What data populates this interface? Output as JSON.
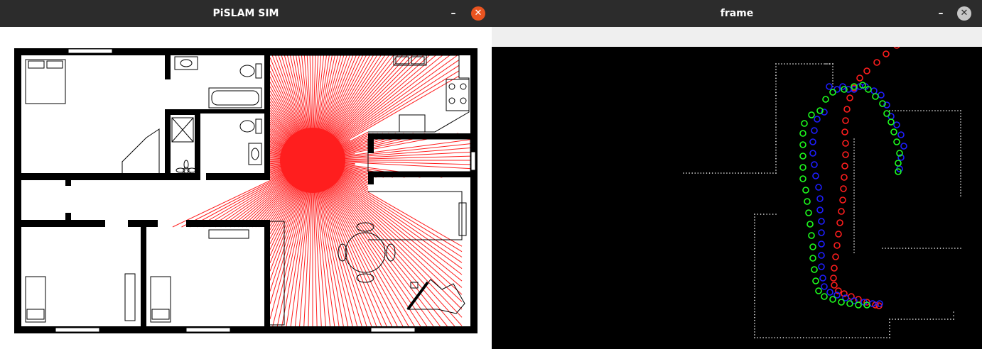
{
  "sim_window": {
    "title": "PiSLAM SIM",
    "min_label": "–",
    "close_label": "✕",
    "close_color": "#e95420"
  },
  "frame_window": {
    "title": "frame",
    "min_label": "–",
    "close_label": "✕",
    "close_color": "#c7c7c7"
  },
  "colors": {
    "wall": "#000000",
    "laser": "#ff1e1e",
    "path_red": "#ff1e1e",
    "path_blue": "#1e1eff",
    "path_green": "#1eff1e",
    "scan_points": "#ffffff"
  },
  "robot": {
    "label": "robot position (laser origin)"
  },
  "icons": [
    "bed-icon",
    "sink-icon",
    "toilet-icon",
    "bathtub-icon",
    "shower-icon",
    "plant-icon",
    "stove-icon",
    "kitchen-sink-icon",
    "table-icon",
    "piano-icon",
    "radiator-icon"
  ]
}
